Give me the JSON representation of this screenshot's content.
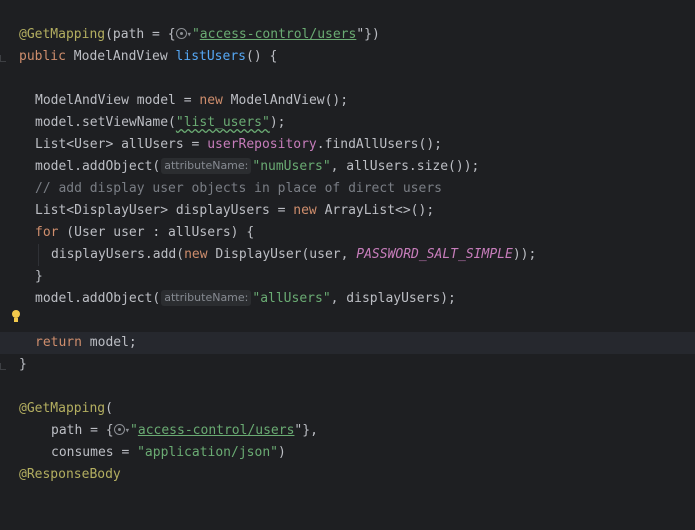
{
  "editor": {
    "lines": {
      "l1": {
        "ann": "@GetMapping",
        "p1": "(path = {",
        "p2": "\"",
        "s1": "access-control/users",
        "p3": "\"})"
      },
      "l2": {
        "kw": "public",
        "p1": " ModelAndView ",
        "fn": "listUsers",
        "p2": "() {"
      },
      "l4": {
        "p1": "ModelAndView model = ",
        "kw": "new",
        "p2": " ModelAndView();"
      },
      "l5": {
        "p1": "model.setViewName(",
        "s1": "\"list_users\"",
        "p2": ");"
      },
      "l6": {
        "p1": "List<User> allUsers = ",
        "field": "userRepository",
        "p2": ".findAllUsers();"
      },
      "l7": {
        "p1": "model.addObject(",
        "hint": "attributeName:",
        "s1": "\"numUsers\"",
        "p2": ", allUsers.size());"
      },
      "l8": {
        "cmt": "// add display user objects in place of direct users"
      },
      "l9": {
        "p1": "List<DisplayUser> displayUsers = ",
        "kw": "new",
        "p2": " ArrayList<>();"
      },
      "l10": {
        "kw": "for",
        "p1": " (User user : allUsers) {"
      },
      "l11": {
        "p1": "displayUsers.add(",
        "kw": "new",
        "p2": " DisplayUser(user, ",
        "const": "PASSWORD_SALT_SIMPLE",
        "p3": "));"
      },
      "l12": {
        "p1": "}"
      },
      "l13": {
        "p1": "model.addObject(",
        "hint": "attributeName:",
        "s1": "\"allUsers\"",
        "p2": ", displayUsers);"
      },
      "l15": {
        "kw": "return",
        "p1": " model;"
      },
      "l16": {
        "p1": "}"
      },
      "l18": {
        "ann": "@GetMapping",
        "p1": "("
      },
      "l19": {
        "p1": "path = {",
        "p2": "\"",
        "s1": "access-control/users",
        "p3": "\"},"
      },
      "l20": {
        "p1": "consumes = ",
        "s1": "\"application/json\"",
        "p2": ")"
      },
      "l21": {
        "ann": "@ResponseBody"
      }
    }
  }
}
